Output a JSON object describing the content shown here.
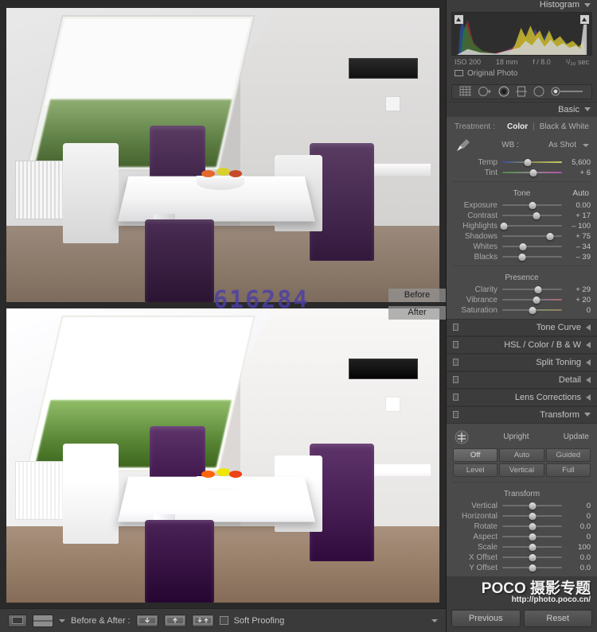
{
  "histogram": {
    "title": "Histogram",
    "exif": {
      "iso": "ISO 200",
      "focal": "18 mm",
      "aperture": "f / 8.0",
      "shutter": "¹/₃₀ sec"
    },
    "original_photo": "Original Photo"
  },
  "tools": [
    "crop-tool",
    "spot-removal-tool",
    "red-eye-tool",
    "graduated-filter-tool",
    "radial-filter-tool",
    "adjustment-brush-tool"
  ],
  "basic": {
    "title": "Basic",
    "treatment_label": "Treatment :",
    "treatment_color": "Color",
    "treatment_bw": "Black & White",
    "wb_label": "WB :",
    "wb_value": "As Shot",
    "white_balance": [
      {
        "name": "Temp",
        "value": "5,600",
        "pos": 42
      },
      {
        "name": "Tint",
        "value": "+ 6",
        "pos": 52
      }
    ],
    "tone_label": "Tone",
    "auto_label": "Auto",
    "tone": [
      {
        "name": "Exposure",
        "value": "0.00",
        "pos": 50
      },
      {
        "name": "Contrast",
        "value": "+ 17",
        "pos": 57
      },
      {
        "name": "Highlights",
        "value": "– 100",
        "pos": 3
      },
      {
        "name": "Shadows",
        "value": "+ 75",
        "pos": 80
      },
      {
        "name": "Whites",
        "value": "– 34",
        "pos": 34
      },
      {
        "name": "Blacks",
        "value": "– 39",
        "pos": 33
      }
    ],
    "presence_label": "Presence",
    "presence": [
      {
        "name": "Clarity",
        "value": "+ 29",
        "pos": 60
      },
      {
        "name": "Vibrance",
        "value": "+ 20",
        "pos": 57
      },
      {
        "name": "Saturation",
        "value": "0",
        "pos": 50
      }
    ]
  },
  "collapsed_panels": [
    {
      "title": "Tone Curve"
    },
    {
      "title": "HSL  /  Color  /  B & W"
    },
    {
      "title": "Split Toning"
    },
    {
      "title": "Detail"
    },
    {
      "title": "Lens Corrections"
    }
  ],
  "transform": {
    "title": "Transform",
    "upright_label": "Upright",
    "update_label": "Update",
    "upright_buttons": [
      "Off",
      "Auto",
      "Guided",
      "Level",
      "Vertical",
      "Full"
    ],
    "upright_selected": "Off",
    "section_label": "Transform",
    "sliders": [
      {
        "name": "Vertical",
        "value": "0",
        "pos": 50
      },
      {
        "name": "Horizontal",
        "value": "0",
        "pos": 50
      },
      {
        "name": "Rotate",
        "value": "0.0",
        "pos": 50
      },
      {
        "name": "Aspect",
        "value": "0",
        "pos": 50
      },
      {
        "name": "Scale",
        "value": "100",
        "pos": 50
      },
      {
        "name": "X Offset",
        "value": "0.0",
        "pos": 50
      },
      {
        "name": "Y Offset",
        "value": "0.0",
        "pos": 50
      }
    ]
  },
  "watermark": {
    "main": "POCO 摄影专题",
    "url": "http://photo.poco.cn/"
  },
  "footer": {
    "previous": "Previous",
    "reset": "Reset"
  },
  "image_view": {
    "before_label": "Before",
    "after_label": "After",
    "overlay_code": "616284"
  },
  "toolbar": {
    "before_after_label": "Before & After :",
    "soft_proofing_label": "Soft Proofing"
  },
  "colors": {
    "panel_bg": "#4a4a4a",
    "panel_chrome": "#3c3c3c",
    "accent_text": "#c8c8c8",
    "watermark_blue": "#4b3fa8"
  }
}
